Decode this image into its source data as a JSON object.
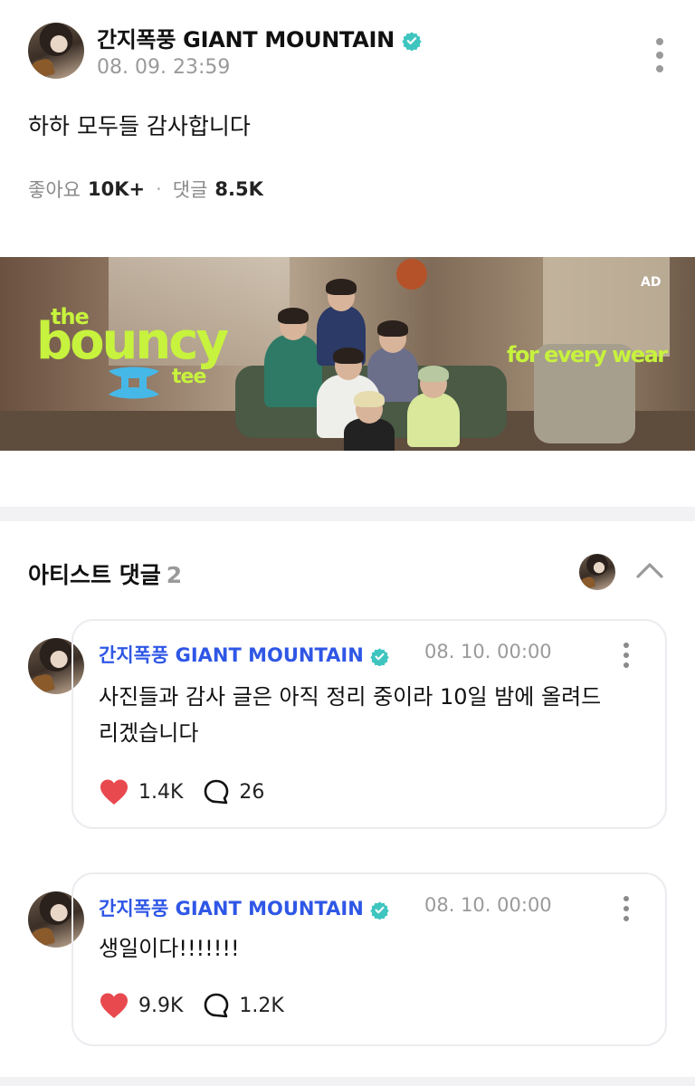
{
  "post": {
    "author": "간지폭풍 GIANT MOUNTAIN",
    "timestamp": "08. 09. 23:59",
    "body": "하하 모두들 감사합니다",
    "likes_label": "좋아요",
    "likes_count": "10K+",
    "comments_label": "댓글",
    "comments_count": "8.5K",
    "icons": {
      "verified": "verified-badge-icon",
      "more": "more-vertical-icon"
    },
    "colors": {
      "verified": "#3fc5c0"
    }
  },
  "ad": {
    "title_small": "the",
    "title_big": "bouncy",
    "title_tail": "tee",
    "slogan": "for every wear",
    "label": "AD",
    "colors": {
      "text": "#c7f23d",
      "logo": "#45b8e8"
    }
  },
  "artist_comments": {
    "title": "아티스트 댓글",
    "count": "2",
    "colors": {
      "name": "#2f57e6",
      "like": "#e8494f"
    },
    "items": [
      {
        "author": "간지폭풍 GIANT MOUNTAIN",
        "timestamp": "08. 10. 00:00",
        "text": "사진들과 감사 글은 아직 정리 중이라 10일 밤에 올려드리겠습니다",
        "likes": "1.4K",
        "replies": "26"
      },
      {
        "author": "간지폭풍 GIANT MOUNTAIN",
        "timestamp": "08. 10. 00:00",
        "text": "생일이다!!!!!!!",
        "likes": "9.9K",
        "replies": "1.2K"
      }
    ]
  }
}
